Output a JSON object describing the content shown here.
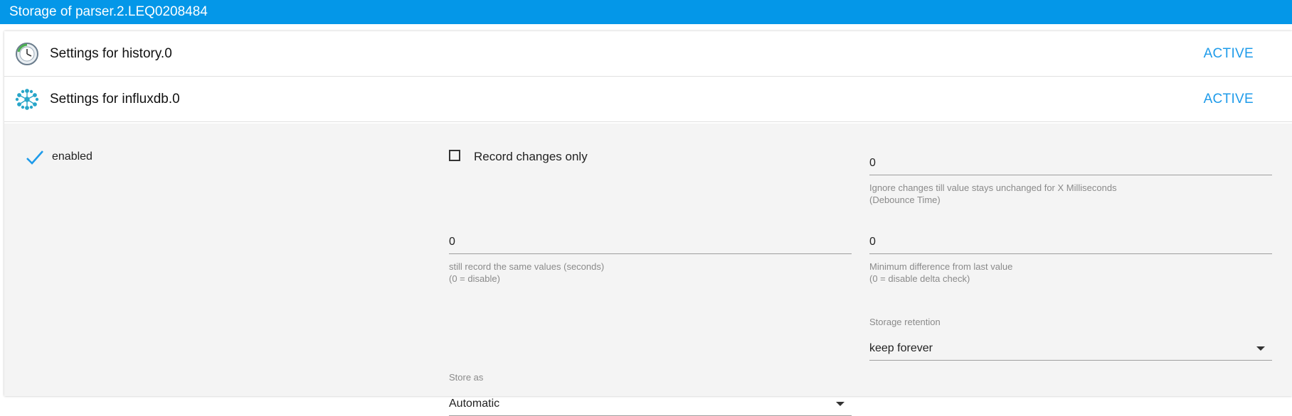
{
  "titlebar": {
    "title": "Storage of parser.2.LEQ0208484"
  },
  "instances": [
    {
      "label": "Settings for history.0",
      "status": "ACTIVE",
      "icon": "history-clock-icon"
    },
    {
      "label": "Settings for influxdb.0",
      "status": "ACTIVE",
      "icon": "influxdb-icon"
    }
  ],
  "settings": {
    "enabled_label": "enabled",
    "enabled": true,
    "record_changes_label": "Record changes only",
    "record_changes_checked": false,
    "debounce": {
      "value": "0",
      "help_line1": "Ignore changes till value stays unchanged for X Milliseconds",
      "help_line2": "(Debounce Time)"
    },
    "same_values": {
      "value": "0",
      "help_line1": "still record the same values (seconds)",
      "help_line2": "(0 = disable)"
    },
    "min_diff": {
      "value": "0",
      "help_line1": "Minimum difference from last value",
      "help_line2": "(0 = disable delta check)"
    },
    "retention": {
      "caption": "Storage retention",
      "value": "keep forever"
    },
    "store_as": {
      "caption": "Store as",
      "value": "Automatic"
    }
  },
  "colors": {
    "accent": "#0497E8",
    "status": "#1E9BEA",
    "panel_bg": "#F4F4F4"
  }
}
